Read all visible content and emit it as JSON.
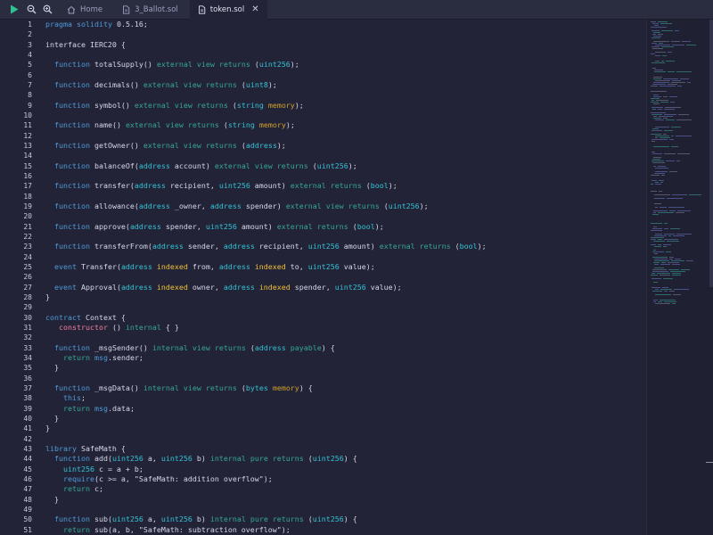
{
  "tabs": [
    {
      "label": "Home",
      "icon": "home-icon",
      "active": false
    },
    {
      "label": "3_Ballot.sol",
      "icon": "file-icon",
      "active": false
    },
    {
      "label": "token.sol",
      "icon": "file-icon",
      "active": true
    }
  ],
  "toolbar": {
    "run": "play-icon",
    "zoom_out": "zoom-out-icon",
    "zoom_in": "zoom-in-icon",
    "close": "close-icon"
  },
  "colors": {
    "background": "#222336",
    "keyword": "#4f9bd8",
    "function": "#36a79b",
    "type": "#35c2d6",
    "memory": "#d3a02c",
    "indexed": "#f0c03a",
    "constructor": "#f27f9f"
  },
  "lines": [
    {
      "n": "1",
      "t": [
        [
          "kw",
          "pragma"
        ],
        [
          "p",
          " "
        ],
        [
          "kw",
          "solidity"
        ],
        [
          "p",
          " 0.5.16;"
        ]
      ]
    },
    {
      "n": "2",
      "t": []
    },
    {
      "n": "3",
      "t": [
        [
          "p",
          "interface IERC20 {"
        ]
      ]
    },
    {
      "n": "4",
      "t": []
    },
    {
      "n": "5",
      "t": [
        [
          "p",
          "  "
        ],
        [
          "kw",
          "function"
        ],
        [
          "p",
          " totalSupply() "
        ],
        [
          "fn",
          "external"
        ],
        [
          "p",
          " "
        ],
        [
          "fn",
          "view"
        ],
        [
          "p",
          " "
        ],
        [
          "fn",
          "returns"
        ],
        [
          "p",
          " ("
        ],
        [
          "ty",
          "uint256"
        ],
        [
          "p",
          ");"
        ]
      ]
    },
    {
      "n": "6",
      "t": []
    },
    {
      "n": "7",
      "t": [
        [
          "p",
          "  "
        ],
        [
          "kw",
          "function"
        ],
        [
          "p",
          " decimals() "
        ],
        [
          "fn",
          "external"
        ],
        [
          "p",
          " "
        ],
        [
          "fn",
          "view"
        ],
        [
          "p",
          " "
        ],
        [
          "fn",
          "returns"
        ],
        [
          "p",
          " ("
        ],
        [
          "ty",
          "uint8"
        ],
        [
          "p",
          ");"
        ]
      ]
    },
    {
      "n": "8",
      "t": []
    },
    {
      "n": "9",
      "t": [
        [
          "p",
          "  "
        ],
        [
          "kw",
          "function"
        ],
        [
          "p",
          " symbol() "
        ],
        [
          "fn",
          "external"
        ],
        [
          "p",
          " "
        ],
        [
          "fn",
          "view"
        ],
        [
          "p",
          " "
        ],
        [
          "fn",
          "returns"
        ],
        [
          "p",
          " ("
        ],
        [
          "ty",
          "string"
        ],
        [
          "p",
          " "
        ],
        [
          "mem",
          "memory"
        ],
        [
          "p",
          ");"
        ]
      ]
    },
    {
      "n": "10",
      "t": []
    },
    {
      "n": "11",
      "t": [
        [
          "p",
          "  "
        ],
        [
          "kw",
          "function"
        ],
        [
          "p",
          " name() "
        ],
        [
          "fn",
          "external"
        ],
        [
          "p",
          " "
        ],
        [
          "fn",
          "view"
        ],
        [
          "p",
          " "
        ],
        [
          "fn",
          "returns"
        ],
        [
          "p",
          " ("
        ],
        [
          "ty",
          "string"
        ],
        [
          "p",
          " "
        ],
        [
          "mem",
          "memory"
        ],
        [
          "p",
          ");"
        ]
      ]
    },
    {
      "n": "12",
      "t": []
    },
    {
      "n": "13",
      "t": [
        [
          "p",
          "  "
        ],
        [
          "kw",
          "function"
        ],
        [
          "p",
          " getOwner() "
        ],
        [
          "fn",
          "external"
        ],
        [
          "p",
          " "
        ],
        [
          "fn",
          "view"
        ],
        [
          "p",
          " "
        ],
        [
          "fn",
          "returns"
        ],
        [
          "p",
          " ("
        ],
        [
          "ty",
          "address"
        ],
        [
          "p",
          ");"
        ]
      ]
    },
    {
      "n": "14",
      "t": []
    },
    {
      "n": "15",
      "t": [
        [
          "p",
          "  "
        ],
        [
          "kw",
          "function"
        ],
        [
          "p",
          " balanceOf("
        ],
        [
          "ty",
          "address"
        ],
        [
          "p",
          " account) "
        ],
        [
          "fn",
          "external"
        ],
        [
          "p",
          " "
        ],
        [
          "fn",
          "view"
        ],
        [
          "p",
          " "
        ],
        [
          "fn",
          "returns"
        ],
        [
          "p",
          " ("
        ],
        [
          "ty",
          "uint256"
        ],
        [
          "p",
          ");"
        ]
      ]
    },
    {
      "n": "16",
      "t": []
    },
    {
      "n": "17",
      "t": [
        [
          "p",
          "  "
        ],
        [
          "kw",
          "function"
        ],
        [
          "p",
          " transfer("
        ],
        [
          "ty",
          "address"
        ],
        [
          "p",
          " recipient, "
        ],
        [
          "ty",
          "uint256"
        ],
        [
          "p",
          " amount) "
        ],
        [
          "fn",
          "external"
        ],
        [
          "p",
          " "
        ],
        [
          "fn",
          "returns"
        ],
        [
          "p",
          " ("
        ],
        [
          "ty",
          "bool"
        ],
        [
          "p",
          ");"
        ]
      ]
    },
    {
      "n": "18",
      "t": []
    },
    {
      "n": "19",
      "t": [
        [
          "p",
          "  "
        ],
        [
          "kw",
          "function"
        ],
        [
          "p",
          " allowance("
        ],
        [
          "ty",
          "address"
        ],
        [
          "p",
          " _owner, "
        ],
        [
          "ty",
          "address"
        ],
        [
          "p",
          " spender) "
        ],
        [
          "fn",
          "external"
        ],
        [
          "p",
          " "
        ],
        [
          "fn",
          "view"
        ],
        [
          "p",
          " "
        ],
        [
          "fn",
          "returns"
        ],
        [
          "p",
          " ("
        ],
        [
          "ty",
          "uint256"
        ],
        [
          "p",
          ");"
        ]
      ]
    },
    {
      "n": "20",
      "t": []
    },
    {
      "n": "21",
      "t": [
        [
          "p",
          "  "
        ],
        [
          "kw",
          "function"
        ],
        [
          "p",
          " approve("
        ],
        [
          "ty",
          "address"
        ],
        [
          "p",
          " spender, "
        ],
        [
          "ty",
          "uint256"
        ],
        [
          "p",
          " amount) "
        ],
        [
          "fn",
          "external"
        ],
        [
          "p",
          " "
        ],
        [
          "fn",
          "returns"
        ],
        [
          "p",
          " ("
        ],
        [
          "ty",
          "bool"
        ],
        [
          "p",
          ");"
        ]
      ]
    },
    {
      "n": "22",
      "t": []
    },
    {
      "n": "23",
      "t": [
        [
          "p",
          "  "
        ],
        [
          "kw",
          "function"
        ],
        [
          "p",
          " transferFrom("
        ],
        [
          "ty",
          "address"
        ],
        [
          "p",
          " sender, "
        ],
        [
          "ty",
          "address"
        ],
        [
          "p",
          " recipient, "
        ],
        [
          "ty",
          "uint256"
        ],
        [
          "p",
          " amount) "
        ],
        [
          "fn",
          "external"
        ],
        [
          "p",
          " "
        ],
        [
          "fn",
          "returns"
        ],
        [
          "p",
          " ("
        ],
        [
          "ty",
          "bool"
        ],
        [
          "p",
          ");"
        ]
      ]
    },
    {
      "n": "24",
      "t": []
    },
    {
      "n": "25",
      "t": [
        [
          "p",
          "  "
        ],
        [
          "kw",
          "event"
        ],
        [
          "p",
          " Transfer("
        ],
        [
          "ty",
          "address"
        ],
        [
          "p",
          " "
        ],
        [
          "idx",
          "indexed"
        ],
        [
          "p",
          " from, "
        ],
        [
          "ty",
          "address"
        ],
        [
          "p",
          " "
        ],
        [
          "idx",
          "indexed"
        ],
        [
          "p",
          " to, "
        ],
        [
          "ty",
          "uint256"
        ],
        [
          "p",
          " value);"
        ]
      ]
    },
    {
      "n": "26",
      "t": []
    },
    {
      "n": "27",
      "t": [
        [
          "p",
          "  "
        ],
        [
          "kw",
          "event"
        ],
        [
          "p",
          " Approval("
        ],
        [
          "ty",
          "address"
        ],
        [
          "p",
          " "
        ],
        [
          "idx",
          "indexed"
        ],
        [
          "p",
          " owner, "
        ],
        [
          "ty",
          "address"
        ],
        [
          "p",
          " "
        ],
        [
          "idx",
          "indexed"
        ],
        [
          "p",
          " spender, "
        ],
        [
          "ty",
          "uint256"
        ],
        [
          "p",
          " value);"
        ]
      ]
    },
    {
      "n": "28",
      "t": [
        [
          "p",
          "}"
        ]
      ]
    },
    {
      "n": "29",
      "t": []
    },
    {
      "n": "30",
      "t": [
        [
          "kw",
          "contract"
        ],
        [
          "p",
          " Context {"
        ]
      ]
    },
    {
      "n": "31",
      "t": [
        [
          "p",
          "   "
        ],
        [
          "ctor",
          "constructor"
        ],
        [
          "p",
          " () "
        ],
        [
          "fn",
          "internal"
        ],
        [
          "p",
          " { }"
        ]
      ]
    },
    {
      "n": "32",
      "t": []
    },
    {
      "n": "33",
      "t": [
        [
          "p",
          "  "
        ],
        [
          "kw",
          "function"
        ],
        [
          "p",
          " _msgSender() "
        ],
        [
          "fn",
          "internal"
        ],
        [
          "p",
          " "
        ],
        [
          "fn",
          "view"
        ],
        [
          "p",
          " "
        ],
        [
          "fn",
          "returns"
        ],
        [
          "p",
          " ("
        ],
        [
          "ty",
          "address"
        ],
        [
          "p",
          " "
        ],
        [
          "fn",
          "payable"
        ],
        [
          "p",
          ") {"
        ]
      ]
    },
    {
      "n": "34",
      "t": [
        [
          "p",
          "    "
        ],
        [
          "fn",
          "return"
        ],
        [
          "p",
          " "
        ],
        [
          "kw",
          "msg"
        ],
        [
          "p",
          ".sender;"
        ]
      ]
    },
    {
      "n": "35",
      "t": [
        [
          "p",
          "  }"
        ]
      ]
    },
    {
      "n": "36",
      "t": []
    },
    {
      "n": "37",
      "t": [
        [
          "p",
          "  "
        ],
        [
          "kw",
          "function"
        ],
        [
          "p",
          " _msgData() "
        ],
        [
          "fn",
          "internal"
        ],
        [
          "p",
          " "
        ],
        [
          "fn",
          "view"
        ],
        [
          "p",
          " "
        ],
        [
          "fn",
          "returns"
        ],
        [
          "p",
          " ("
        ],
        [
          "ty",
          "bytes"
        ],
        [
          "p",
          " "
        ],
        [
          "mem",
          "memory"
        ],
        [
          "p",
          ") {"
        ]
      ]
    },
    {
      "n": "38",
      "t": [
        [
          "p",
          "    "
        ],
        [
          "kw",
          "this"
        ],
        [
          "p",
          ";"
        ]
      ]
    },
    {
      "n": "39",
      "t": [
        [
          "p",
          "    "
        ],
        [
          "fn",
          "return"
        ],
        [
          "p",
          " "
        ],
        [
          "kw",
          "msg"
        ],
        [
          "p",
          ".data;"
        ]
      ]
    },
    {
      "n": "40",
      "t": [
        [
          "p",
          "  }"
        ]
      ]
    },
    {
      "n": "41",
      "t": [
        [
          "p",
          "}"
        ]
      ]
    },
    {
      "n": "42",
      "t": []
    },
    {
      "n": "43",
      "t": [
        [
          "kw",
          "library"
        ],
        [
          "p",
          " SafeMath {"
        ]
      ]
    },
    {
      "n": "44",
      "t": [
        [
          "p",
          "  "
        ],
        [
          "kw",
          "function"
        ],
        [
          "p",
          " add("
        ],
        [
          "ty",
          "uint256"
        ],
        [
          "p",
          " a, "
        ],
        [
          "ty",
          "uint256"
        ],
        [
          "p",
          " b) "
        ],
        [
          "fn",
          "internal"
        ],
        [
          "p",
          " "
        ],
        [
          "fn",
          "pure"
        ],
        [
          "p",
          " "
        ],
        [
          "fn",
          "returns"
        ],
        [
          "p",
          " ("
        ],
        [
          "ty",
          "uint256"
        ],
        [
          "p",
          ") {"
        ]
      ]
    },
    {
      "n": "45",
      "t": [
        [
          "p",
          "    "
        ],
        [
          "ty",
          "uint256"
        ],
        [
          "p",
          " c = a + b;"
        ]
      ]
    },
    {
      "n": "46",
      "t": [
        [
          "p",
          "    "
        ],
        [
          "kw",
          "require"
        ],
        [
          "p",
          "(c >= a, "
        ],
        [
          "str",
          "\"SafeMath: addition overflow\""
        ],
        [
          "p",
          ");"
        ]
      ]
    },
    {
      "n": "47",
      "t": [
        [
          "p",
          "    "
        ],
        [
          "fn",
          "return"
        ],
        [
          "p",
          " c;"
        ]
      ]
    },
    {
      "n": "48",
      "t": [
        [
          "p",
          "  }"
        ]
      ]
    },
    {
      "n": "49",
      "t": []
    },
    {
      "n": "50",
      "t": [
        [
          "p",
          "  "
        ],
        [
          "kw",
          "function"
        ],
        [
          "p",
          " sub("
        ],
        [
          "ty",
          "uint256"
        ],
        [
          "p",
          " a, "
        ],
        [
          "ty",
          "uint256"
        ],
        [
          "p",
          " b) "
        ],
        [
          "fn",
          "internal"
        ],
        [
          "p",
          " "
        ],
        [
          "fn",
          "pure"
        ],
        [
          "p",
          " "
        ],
        [
          "fn",
          "returns"
        ],
        [
          "p",
          " ("
        ],
        [
          "ty",
          "uint256"
        ],
        [
          "p",
          ") {"
        ]
      ]
    },
    {
      "n": "51",
      "t": [
        [
          "p",
          "    "
        ],
        [
          "fn",
          "return"
        ],
        [
          "p",
          " sub(a, b, "
        ],
        [
          "str",
          "\"SafeMath: subtraction overflow\""
        ],
        [
          "p",
          ");"
        ]
      ]
    }
  ]
}
